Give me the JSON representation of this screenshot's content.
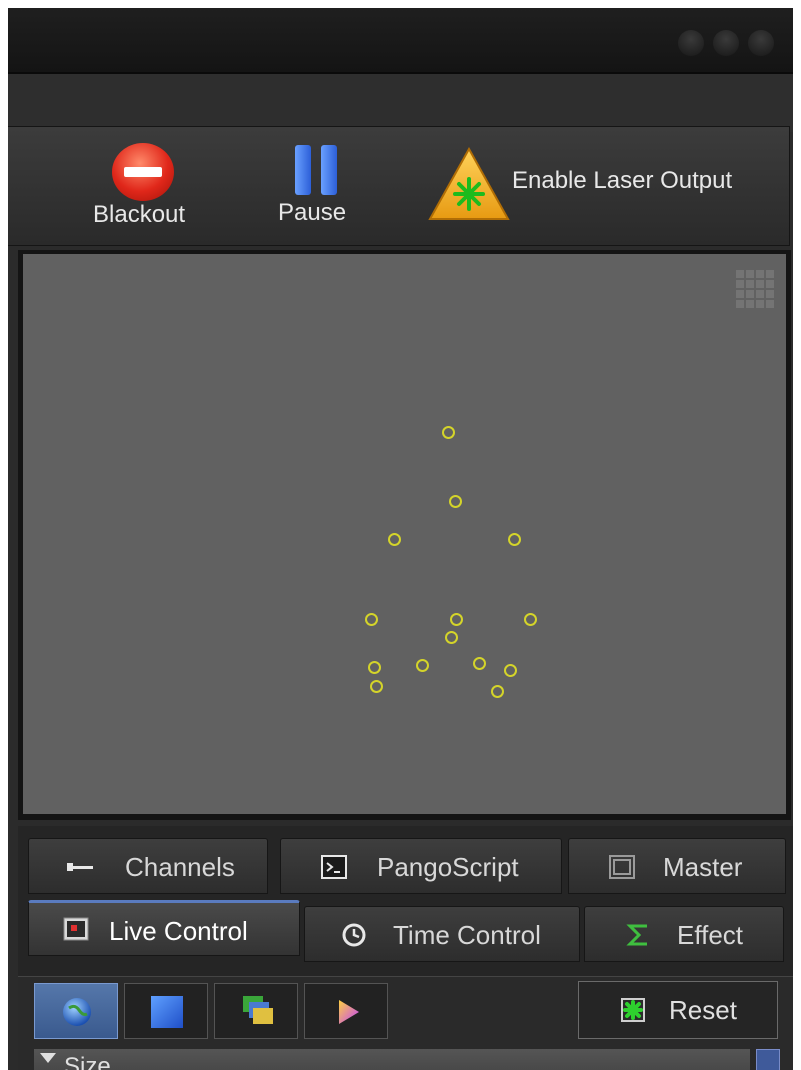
{
  "toolbar": {
    "blackout_label": "Blackout",
    "pause_label": "Pause",
    "enable_laser_label": "Enable Laser Output"
  },
  "tabs": {
    "row1": [
      {
        "label": "Channels",
        "icon": "slider-icon"
      },
      {
        "label": "PangoScript",
        "icon": "terminal-icon"
      },
      {
        "label": "Master",
        "icon": "window-icon"
      }
    ],
    "row2": [
      {
        "label": "Live Control",
        "icon": "live-control-icon",
        "active": true
      },
      {
        "label": "Time Control",
        "icon": "clock-icon"
      },
      {
        "label": "Effect",
        "icon": "sigma-icon"
      }
    ]
  },
  "subtoolbar": {
    "buttons": [
      "globe-icon",
      "blue-square-icon",
      "layers-icon",
      "arrow-play-icon"
    ],
    "reset_label": "Reset"
  },
  "section": {
    "size_label": "Size"
  },
  "colors": {
    "canvas_bg": "#616161",
    "point_color": "#d4d42a",
    "panel_bg": "#2b2b2b",
    "active_tab_accent": "#5a7bbf"
  }
}
